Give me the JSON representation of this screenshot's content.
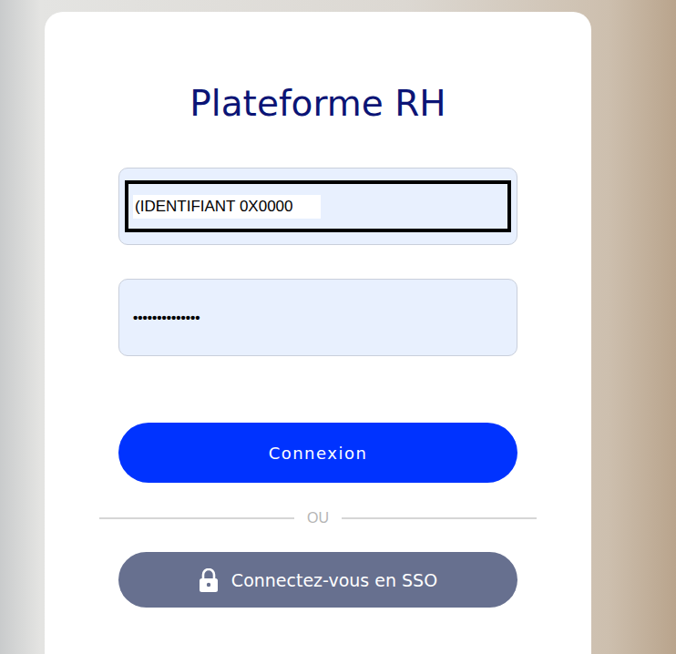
{
  "title": "Plateforme RH",
  "fields": [
    {
      "kind": "text",
      "value": "(IDENTIFIANT 0X0000"
    },
    {
      "kind": "password",
      "value": "••••••••••••••"
    }
  ],
  "login_button": "Connexion",
  "divider": "OU",
  "sso_button": "Connectez-vous en SSO"
}
